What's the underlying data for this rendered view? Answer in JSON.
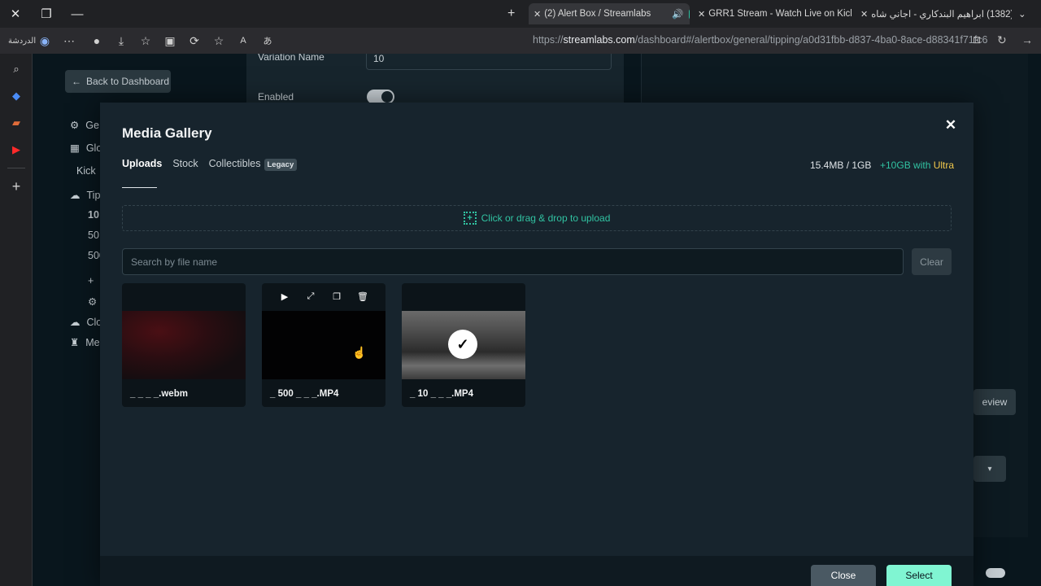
{
  "browser": {
    "address_prefix": "https://",
    "address_host": "streamlabs.com",
    "address_path": "/dashboard#/alertbox/general/tipping/a0d31fbb-d837-4ba0-8ace-d88341f71fc6",
    "profile_label": "الدردشة",
    "tabs": [
      {
        "label": "(2) Alert Box / Streamlabs",
        "color": "#31c3a2"
      },
      {
        "label": "GRR1 Stream - Watch Live on Kick",
        "color": "#53fc18"
      },
      {
        "label": "(1382) ابراهيم البندكاري - اجاني شاه",
        "color": "#ff0000"
      }
    ]
  },
  "background": {
    "back_label": "Back to Dashboard",
    "variation_label": "Variation Name",
    "variation_value": "10",
    "enabled_label": "Enabled",
    "nav": [
      "Ge",
      "Glo",
      "Kick",
      "Tip",
      "10",
      "50",
      "500",
      "Clo",
      "Me"
    ],
    "preview_label": "eview"
  },
  "modal": {
    "title": "Media Gallery",
    "tabs": {
      "uploads": "Uploads",
      "stock": "Stock",
      "collectibles": "Collectibles",
      "legacy_badge": "Legacy"
    },
    "storage_used": "15.4MB / 1GB",
    "upgrade_prefix": "+10GB with ",
    "upgrade_brand": "Ultra",
    "upload_label": "Click or drag & drop to upload",
    "search_placeholder": "Search by file name",
    "clear_label": "Clear",
    "items": [
      {
        "name": "_ _ _ _.webm"
      },
      {
        "name": "_ 500 _ _ _.MP4"
      },
      {
        "name": "_ 10 _ _ _.MP4",
        "selected": true
      }
    ],
    "close_label": "Close",
    "select_label": "Select"
  },
  "colors": {
    "accent": "#31c3a2",
    "select_button": "#80f5d2",
    "ultra": "#f2c94c"
  }
}
